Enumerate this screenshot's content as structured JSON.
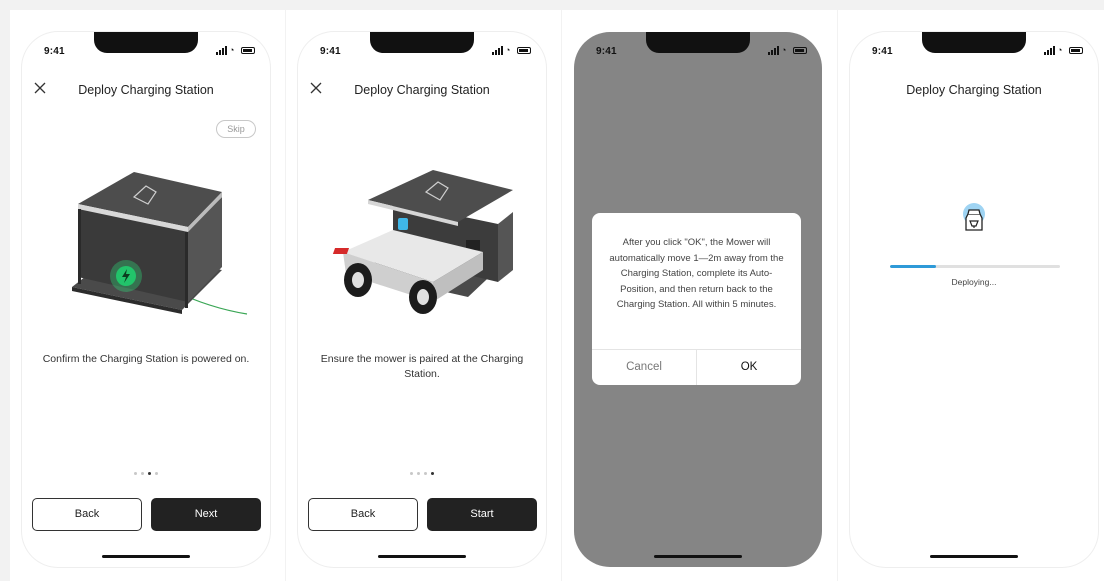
{
  "status": {
    "time": "9:41"
  },
  "screens": [
    {
      "title": "Deploy Charging Station",
      "skip_label": "Skip",
      "caption": "Confirm the Charging Station is powered on.",
      "dots_total": 4,
      "dots_active": 2,
      "back_label": "Back",
      "next_label": "Next"
    },
    {
      "title": "Deploy Charging Station",
      "caption": "Ensure the mower is paired at the Charging Station.",
      "dots_total": 4,
      "dots_active": 3,
      "back_label": "Back",
      "start_label": "Start"
    },
    {
      "dialog": {
        "message": "After you click \"OK\", the Mower will automatically move 1—2m away from the Charging Station, complete its Auto-Position, and then return back to the Charging Station. All within 5 minutes.",
        "cancel_label": "Cancel",
        "ok_label": "OK"
      }
    },
    {
      "title": "Deploy Charging Station",
      "progress": 0.27,
      "progress_label": "Deploying..."
    }
  ],
  "colors": {
    "primary": "#222222",
    "accent_blue": "#2e9ad8",
    "power_green": "#2ee07a",
    "overlay": "#858585"
  },
  "icons": {
    "close": "close-icon",
    "power": "lightning-icon",
    "deploy": "charging-station-icon"
  }
}
